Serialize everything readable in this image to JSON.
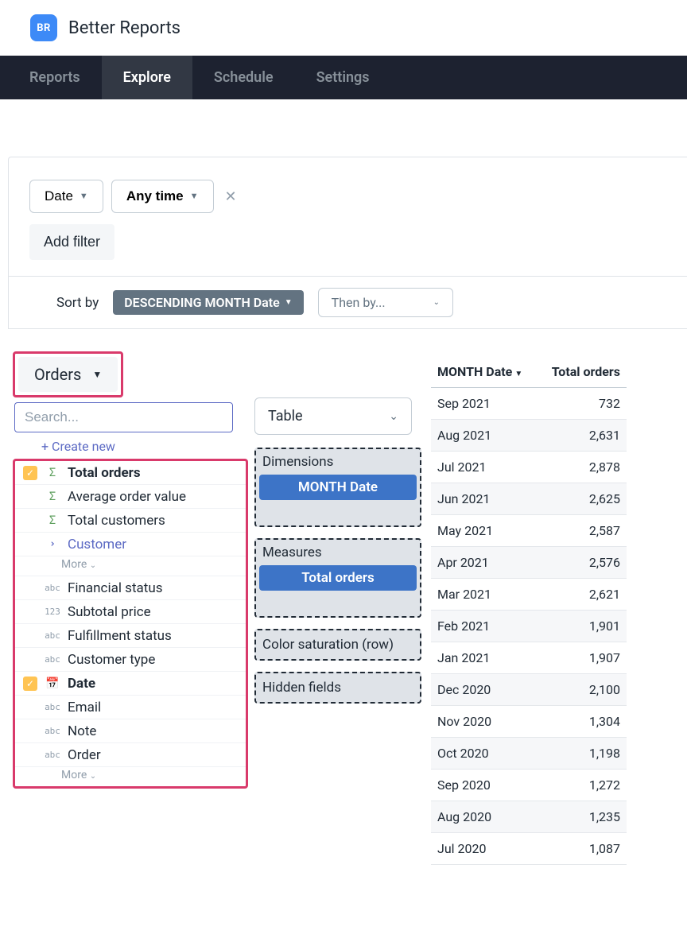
{
  "header": {
    "logo_text": "BR",
    "app_title": "Better Reports"
  },
  "nav": {
    "items": [
      {
        "label": "Reports"
      },
      {
        "label": "Explore"
      },
      {
        "label": "Schedule"
      },
      {
        "label": "Settings"
      }
    ],
    "active": "Explore"
  },
  "filters": {
    "date_label": "Date",
    "any_time_label": "Any time",
    "add_filter_label": "Add filter"
  },
  "sort": {
    "label": "Sort by",
    "primary": "DESCENDING MONTH Date",
    "then_by_placeholder": "Then by..."
  },
  "source": {
    "label": "Orders"
  },
  "search": {
    "placeholder": "Search...",
    "create_new": "+ Create new"
  },
  "fields": [
    {
      "checked": true,
      "type": "sigma",
      "label": "Total orders",
      "bold": true
    },
    {
      "checked": false,
      "type": "sigma",
      "label": "Average order value"
    },
    {
      "checked": false,
      "type": "sigma",
      "label": "Total customers"
    },
    {
      "checked": false,
      "type": "chevron",
      "label": "Customer",
      "link": true
    },
    {
      "more": true,
      "label": "More"
    },
    {
      "checked": false,
      "type": "abc",
      "label": "Financial status"
    },
    {
      "checked": false,
      "type": "123",
      "label": "Subtotal price"
    },
    {
      "checked": false,
      "type": "abc",
      "label": "Fulfillment status"
    },
    {
      "checked": false,
      "type": "abc",
      "label": "Customer type"
    },
    {
      "checked": true,
      "type": "date",
      "label": "Date",
      "bold": true
    },
    {
      "checked": false,
      "type": "abc",
      "label": "Email"
    },
    {
      "checked": false,
      "type": "abc",
      "label": "Note"
    },
    {
      "checked": false,
      "type": "abc",
      "label": "Order"
    },
    {
      "more": true,
      "label": "More"
    }
  ],
  "viz": {
    "type_label": "Table",
    "zones": {
      "dimensions_title": "Dimensions",
      "dimensions_chip": "MONTH Date",
      "measures_title": "Measures",
      "measures_chip": "Total orders",
      "color_title": "Color saturation (row)",
      "hidden_title": "Hidden fields"
    }
  },
  "table": {
    "col1": "MONTH Date",
    "col2": "Total orders"
  },
  "chart_data": {
    "type": "table",
    "columns": [
      "MONTH Date",
      "Total orders"
    ],
    "rows": [
      [
        "Sep 2021",
        "732"
      ],
      [
        "Aug 2021",
        "2,631"
      ],
      [
        "Jul 2021",
        "2,878"
      ],
      [
        "Jun 2021",
        "2,625"
      ],
      [
        "May 2021",
        "2,587"
      ],
      [
        "Apr 2021",
        "2,576"
      ],
      [
        "Mar 2021",
        "2,621"
      ],
      [
        "Feb 2021",
        "1,901"
      ],
      [
        "Jan 2021",
        "1,907"
      ],
      [
        "Dec 2020",
        "2,100"
      ],
      [
        "Nov 2020",
        "1,304"
      ],
      [
        "Oct 2020",
        "1,198"
      ],
      [
        "Sep 2020",
        "1,272"
      ],
      [
        "Aug 2020",
        "1,235"
      ],
      [
        "Jul 2020",
        "1,087"
      ]
    ]
  }
}
